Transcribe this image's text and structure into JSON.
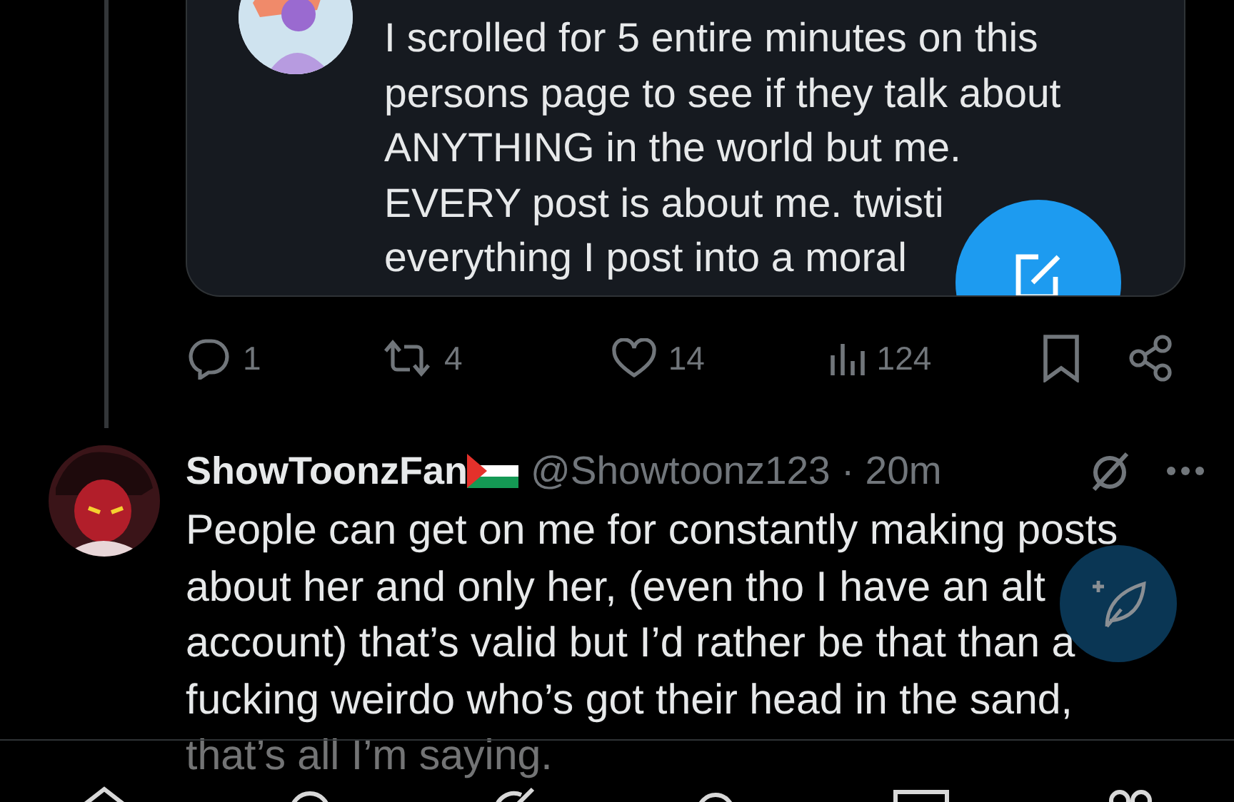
{
  "quoted_post": {
    "lines": [
      "I scrolled for 5 entire minutes on this",
      "persons page to see if they talk about",
      "ANYTHING in the world but me.",
      "EVERY post is about me. twisti",
      "everything I post into a moral"
    ]
  },
  "actions": [
    {
      "kind": "reply",
      "count": "1"
    },
    {
      "kind": "repost",
      "count": "4"
    },
    {
      "kind": "like",
      "count": "14"
    },
    {
      "kind": "views",
      "count": "124"
    },
    {
      "kind": "bookmark"
    },
    {
      "kind": "share"
    }
  ],
  "post": {
    "name": "ShowToonzFan",
    "meta": "@Showtoonz123 · 20m",
    "lines": [
      "People can get on me for constantly making posts",
      "about her and only her, (even tho I have an alt",
      "account) that’s valid but I’d rather be that than a",
      "fucking weirdo who’s got their head in the sand,",
      "that’s all I’m saying."
    ]
  }
}
